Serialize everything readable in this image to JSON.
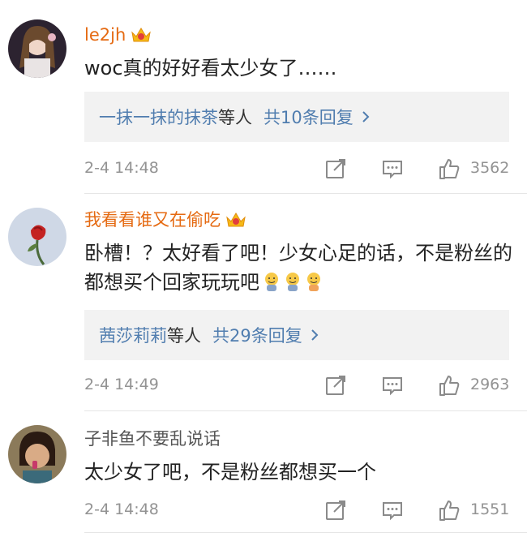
{
  "comments": [
    {
      "username": "le2jh",
      "text": "woc真的好好看太少女了……",
      "replies": {
        "user": "一抹一抹的抹茶",
        "suffix": "等人",
        "count": "共10条回复"
      },
      "time": "2-4 14:48",
      "likes": "3562"
    },
    {
      "username": "我看看谁又在偷吃",
      "text": "卧槽！？太好看了吧！少女心足的话，不是粉丝的都想买个回家玩玩吧",
      "emoji": [
        "sweat-smile-emoji",
        "sweat-smile-emoji",
        "sweat-smile-emoji"
      ],
      "replies": {
        "user": "茜莎莉莉",
        "suffix": "等人",
        "count": "共29条回复"
      },
      "time": "2-4 14:49",
      "likes": "2963"
    },
    {
      "username": "子非鱼不要乱说话",
      "text": "太少女了吧，不是粉丝都想买一个",
      "time": "2-4 14:48",
      "likes": "1551"
    }
  ],
  "icons": [
    "crown-icon",
    "share-icon",
    "comment-icon",
    "thumbs-up-icon",
    "chevron-right-icon"
  ],
  "colors": {
    "vip_name": "#e56a12",
    "link": "#507daf",
    "meta": "#939393"
  }
}
